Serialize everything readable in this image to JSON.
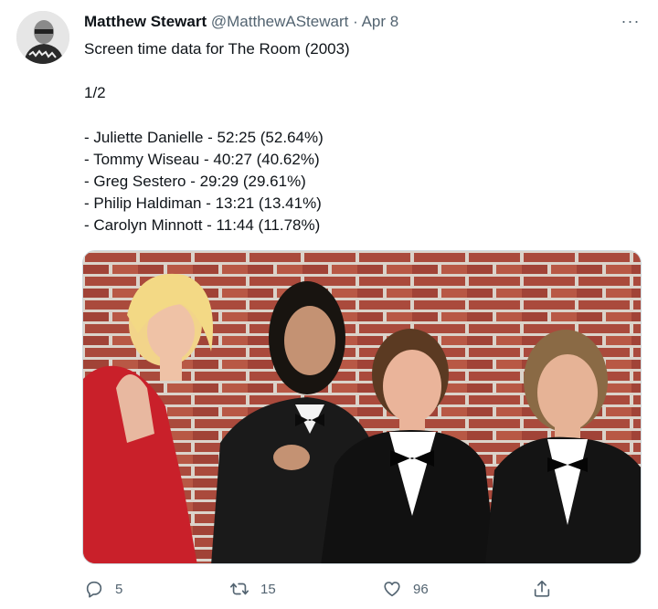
{
  "tweet": {
    "author_name": "Matthew Stewart",
    "author_handle": "@MatthewAStewart",
    "separator": "·",
    "date": "Apr 8",
    "more_label": "···",
    "lines": [
      "Screen time data for The Room (2003)",
      "1/2",
      "- Juliette Danielle - 52:25 (52.64%)",
      "- Tommy Wiseau - 40:27 (40.62%)",
      "- Greg Sestero - 29:29 (29.61%)",
      "- Philip Haldiman - 13:21 (13.41%)",
      "- Carolyn Minnott - 11:44 (11.78%)"
    ]
  },
  "actions": {
    "reply_count": "5",
    "retweet_count": "15",
    "like_count": "96"
  },
  "icons": {
    "reply": "reply-icon",
    "retweet": "retweet-icon",
    "like": "like-icon",
    "share": "share-icon",
    "more": "more-icon"
  },
  "colors": {
    "text": "#0f1419",
    "secondary": "#536471",
    "brick": "#a33b2c",
    "mortar": "#d8d0c6"
  }
}
